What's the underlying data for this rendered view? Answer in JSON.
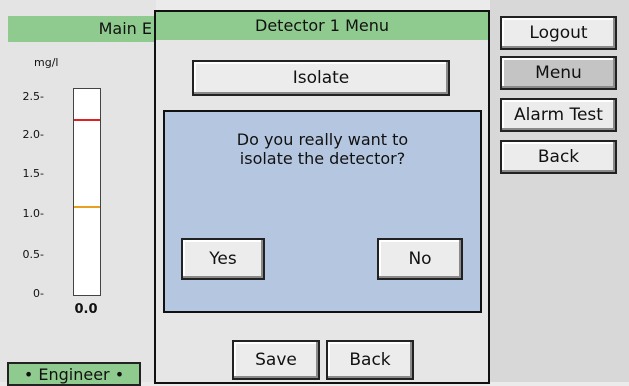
{
  "left_panel": {
    "title": "Main E",
    "unit": "mg/l",
    "ticks": [
      "2.5-",
      "2.0-",
      "1.5-",
      "1.0-",
      "0.5-",
      "0-"
    ],
    "reading": "0.0",
    "engineer_label": "• Engineer •",
    "colors": {
      "high_limit": "#e02020",
      "low_limit": "#e8a020"
    }
  },
  "menu": {
    "title": "Detector 1 Menu",
    "isolate_label": "Isolate",
    "save_label": "Save",
    "back_label": "Back"
  },
  "right_column": {
    "logout_label": "Logout",
    "menu_label": "Menu",
    "alarm_test_label": "Alarm Test",
    "back_label": "Back"
  },
  "dialog": {
    "message_line1": "Do you really want to",
    "message_line2": "isolate the detector?",
    "yes_label": "Yes",
    "no_label": "No"
  },
  "colors": {
    "title_bar": "#8fcb8f",
    "dialog_bg": "#b5c7e0"
  }
}
